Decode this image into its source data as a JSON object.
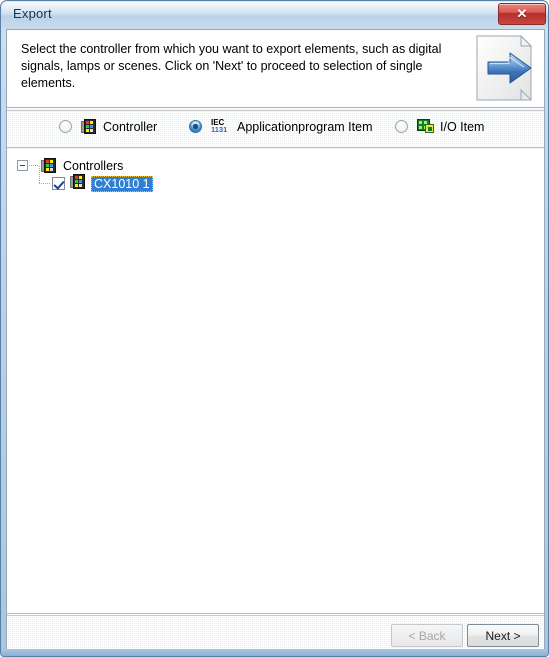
{
  "window": {
    "title": "Export",
    "close_label": "✕"
  },
  "header": {
    "instruction": "Select the controller from which you want to export elements, such as digital signals, lamps or scenes. Click on 'Next' to proceed to selection of single elements.",
    "icon": "export-document-arrow-icon"
  },
  "options": {
    "items": [
      {
        "label": "Controller",
        "icon": "controller-icon",
        "selected": false
      },
      {
        "label": "Applicationprogram Item",
        "icon": "iec-1131-icon",
        "selected": true
      },
      {
        "label": "I/O Item",
        "icon": "io-item-icon",
        "selected": false
      }
    ],
    "iec_icon_top": "IEC",
    "iec_icon_bottom": "1131"
  },
  "tree": {
    "root": {
      "label": "Controllers",
      "expanded": true,
      "icon": "controller-icon"
    },
    "children": [
      {
        "label": "CX1010 1",
        "checked": true,
        "selected": true,
        "icon": "controller-icon"
      }
    ]
  },
  "footer": {
    "back_label": "< Back",
    "back_enabled": false,
    "next_label": "Next >",
    "next_enabled": true
  },
  "colors": {
    "titlebar_start": "#dfeaf6",
    "titlebar_end": "#c9dced",
    "close_red": "#c9453e",
    "selection_blue": "#2f7fd4",
    "focus_outline": "#f0c030",
    "band_gray": "#eceff1"
  }
}
